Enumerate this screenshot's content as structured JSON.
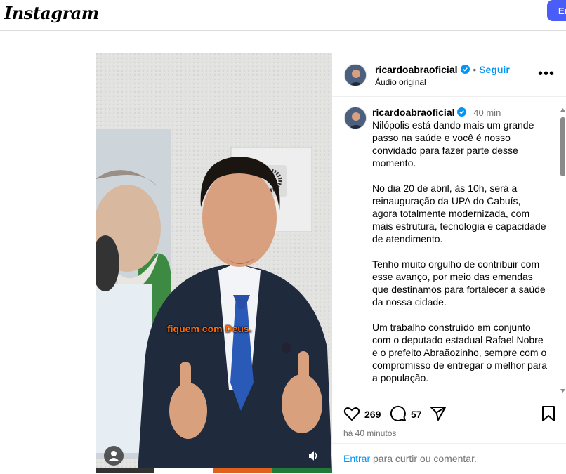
{
  "brand": {
    "logo_text": "Instagram",
    "top_button_label": "En"
  },
  "post": {
    "author": "ricardoabraoficial",
    "follow_label": "Seguir",
    "audio_label": "Áudio original",
    "time_ago": "40 min",
    "subtitle_caption": "fiquem com Deus.",
    "caption_paragraphs": [
      "Nilópolis está dando mais um grande passo na saúde e você é nosso convidado para fazer parte desse momento.",
      "No dia 20 de abril, às 10h, será a reinauguração da UPA do Cabuís, agora totalmente modernizada, com mais estrutura, tecnologia e capacidade de atendimento.",
      "Tenho muito orgulho de contribuir com esse avanço, por meio das emendas que destinamos para fortalecer a saúde da nossa cidade.",
      "Um trabalho construído em conjunto com o deputado estadual Rafael Nobre e o prefeito Abraãozinho, sempre com o compromisso de entregar o melhor para a população."
    ],
    "likes": "269",
    "comments": "57",
    "posted_ago": "há 40 minutos"
  },
  "comment_box": {
    "link": "Entrar",
    "rest": "para curtir ou comentar."
  },
  "icons": [
    "heart-icon",
    "comment-icon",
    "share-icon",
    "bookmark-icon",
    "verified-icon",
    "more-icon",
    "user-tag-icon",
    "volume-icon"
  ],
  "colors": {
    "accent": "#0095f6",
    "verified": "#0095f6",
    "button": "#4a5df9",
    "subtitle_orange": "#ff6a00"
  }
}
